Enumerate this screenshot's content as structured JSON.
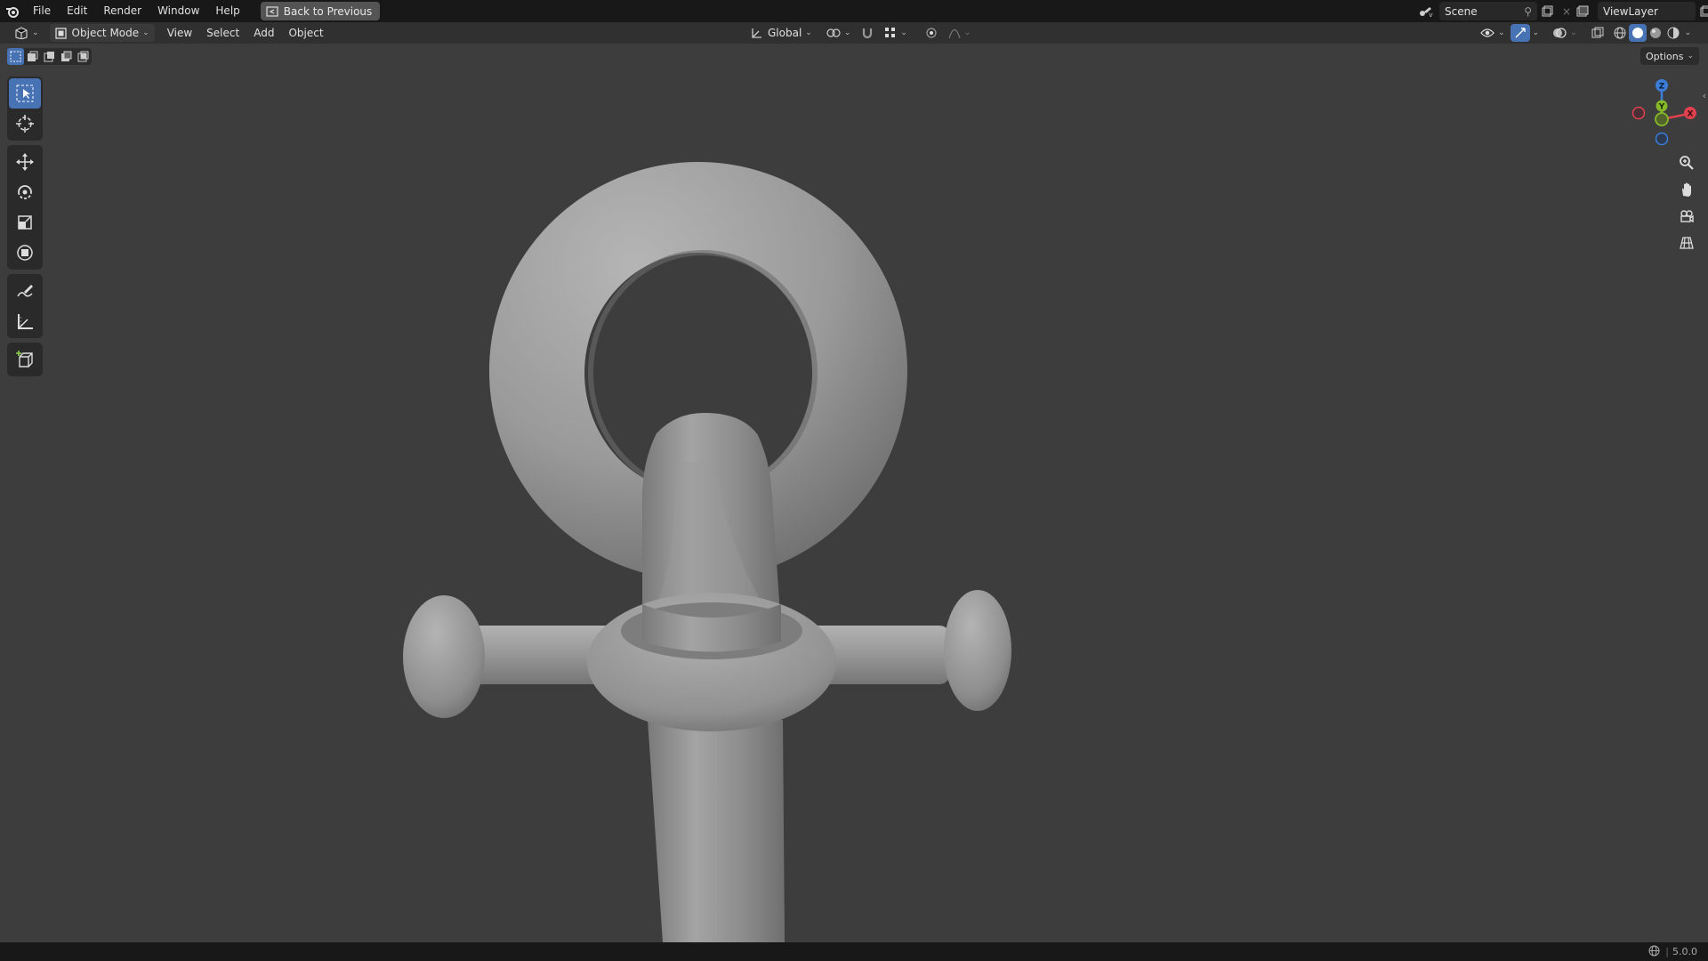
{
  "topbar": {
    "menus": [
      "File",
      "Edit",
      "Render",
      "Window",
      "Help"
    ],
    "back_label": "Back to Previous",
    "scene": "Scene",
    "view_layer": "ViewLayer"
  },
  "header": {
    "mode": "Object Mode",
    "menus": [
      "View",
      "Select",
      "Add",
      "Object"
    ],
    "transform_orientation": "Global"
  },
  "options_label": "Options",
  "gizmo": {
    "x": "X",
    "y": "Y",
    "z": "Z"
  },
  "status": {
    "version": "5.0.0"
  },
  "colors": {
    "accent": "#4772b3",
    "axis_x": "#e0414f",
    "axis_y": "#86b82a",
    "axis_z": "#3b7dd8"
  }
}
